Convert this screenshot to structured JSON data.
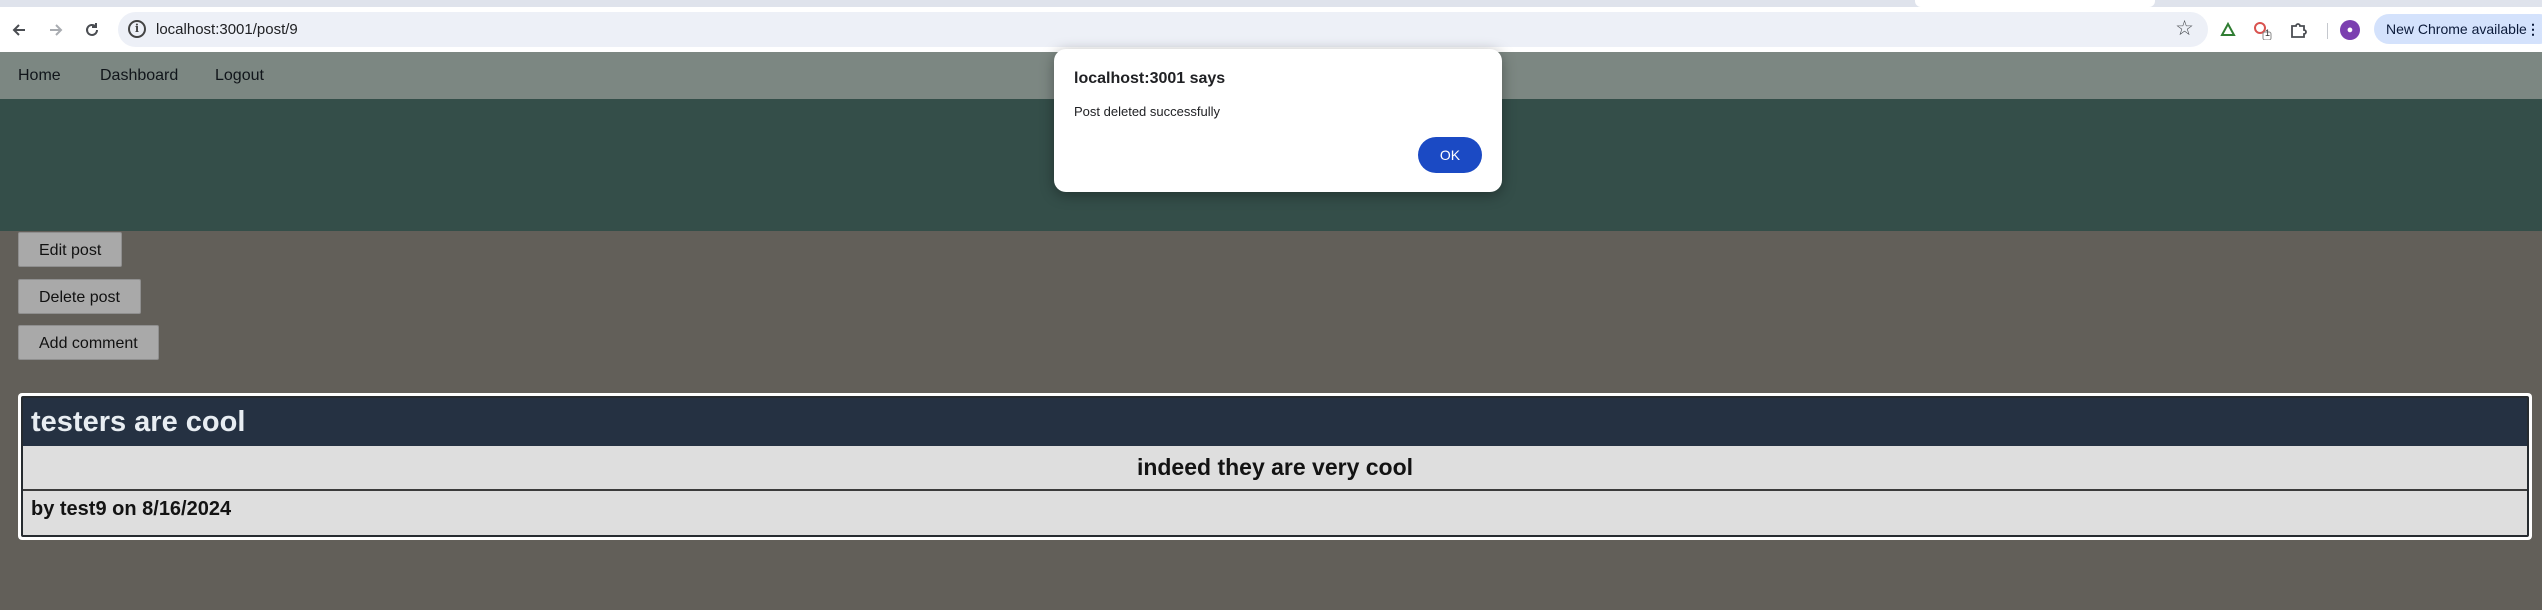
{
  "browser": {
    "url": "localhost:3001/post/9",
    "update_chip": "New Chrome available",
    "icons": {
      "back": "arrow-left-icon",
      "forward": "arrow-right-icon",
      "reload": "reload-icon",
      "site_info": "info-icon",
      "bookmark": "star-icon",
      "extension1": "extension-icon",
      "extension2": "extension-badge-icon",
      "extensions": "puzzle-icon",
      "menu": "kebab-menu-icon"
    },
    "badge_count": "1"
  },
  "navbar": {
    "home": "Home",
    "dashboard": "Dashboard",
    "logout": "Logout"
  },
  "actions": {
    "edit": "Edit post",
    "delete": "Delete post",
    "comment": "Add comment"
  },
  "post": {
    "title": "testers are cool",
    "content": "indeed they are very cool",
    "meta": "by test9 on 8/16/2024"
  },
  "dialog": {
    "title": "localhost:3001 says",
    "message": "Post deleted successfully",
    "ok": "OK"
  },
  "colors": {
    "navbar": "#7c8782",
    "hero": "#344e49",
    "page": "#625f59",
    "card_title": "#253142",
    "ok_button": "#1b4ac4"
  }
}
